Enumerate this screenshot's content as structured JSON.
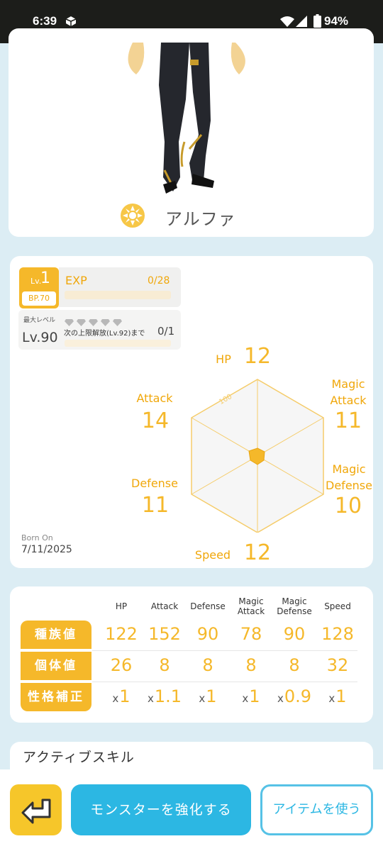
{
  "status_bar": {
    "time": "6:39",
    "battery": "94%"
  },
  "monster": {
    "name": "アルファ"
  },
  "level": {
    "prefix": "Lv.",
    "value": "1",
    "bp": "BP.70",
    "exp_label": "EXP",
    "exp_value": "0/28",
    "exp_progress": 0,
    "max_level_label": "最大レベル",
    "max_level": "Lv.90",
    "next_limit_label": "次の上限解放(Lv.92)まで",
    "limit_count": "0/1",
    "limit_progress": 0
  },
  "stats": {
    "hp": {
      "label": "HP",
      "value": "12"
    },
    "magic_attack": {
      "label": "Magic\nAttack",
      "value": "11"
    },
    "magic_defense": {
      "label": "Magic\nDefense",
      "value": "10"
    },
    "speed": {
      "label": "Speed",
      "value": "12"
    },
    "defense": {
      "label": "Defense",
      "value": "11"
    },
    "attack": {
      "label": "Attack",
      "value": "14"
    },
    "radar_scale_label": "100"
  },
  "born": {
    "label": "Born On",
    "date": "7/11/2025"
  },
  "table": {
    "headers": [
      "HP",
      "Attack",
      "Defense",
      "Magic\nAttack",
      "Magic\nDefense",
      "Speed"
    ],
    "rows": [
      {
        "label": "種族値",
        "values": [
          "122",
          "152",
          "90",
          "78",
          "90",
          "128"
        ]
      },
      {
        "label": "個体値",
        "values": [
          "26",
          "8",
          "8",
          "8",
          "8",
          "32"
        ]
      },
      {
        "label": "性格補正",
        "prefix": "x",
        "values": [
          "1",
          "1.1",
          "1",
          "1",
          "0.9",
          "1"
        ]
      }
    ]
  },
  "skill_section": {
    "title": "アクティブスキル"
  },
  "bottom": {
    "enhance_label": "モンスターを強化する",
    "item_label": "アイテムを使う"
  },
  "colors": {
    "accent": "#f5b82a",
    "primary": "#2cb7e3",
    "back_button": "#f6c62a"
  }
}
